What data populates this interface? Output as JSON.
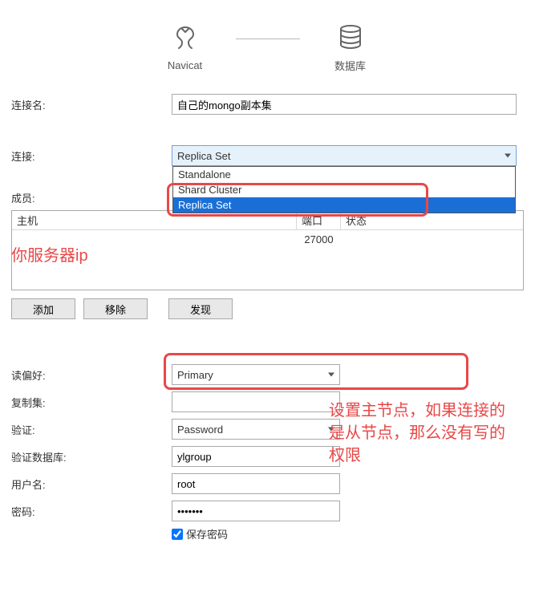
{
  "header": {
    "left_label": "Navicat",
    "right_label": "数据库"
  },
  "fields": {
    "conn_name_label": "连接名:",
    "conn_name_value": "自己的mongo副本集",
    "conn_type_label": "连接:",
    "conn_type_value": "Replica Set",
    "conn_type_options": [
      "Standalone",
      "Shard Cluster",
      "Replica Set"
    ],
    "members_label": "成员:",
    "table": {
      "host_header": "主机",
      "port_header": "端口",
      "status_header": "状态",
      "rows": [
        {
          "host": "",
          "port": "27000",
          "status": ""
        }
      ]
    },
    "buttons": {
      "add": "添加",
      "remove": "移除",
      "discover": "发现"
    },
    "read_pref_label": "读偏好:",
    "read_pref_value": "Primary",
    "replica_set_label": "复制集:",
    "replica_set_value": "",
    "auth_label": "验证:",
    "auth_value": "Password",
    "auth_db_label": "验证数据库:",
    "auth_db_value": "ylgroup",
    "user_label": "用户名:",
    "user_value": "root",
    "pwd_label": "密码:",
    "pwd_value": "•••••••",
    "save_pwd_label": "保存密码"
  },
  "annotations": {
    "server_ip": "你服务器ip",
    "note_primary": "设置主节点，如果连接的是从节点，那么没有写的权限"
  }
}
